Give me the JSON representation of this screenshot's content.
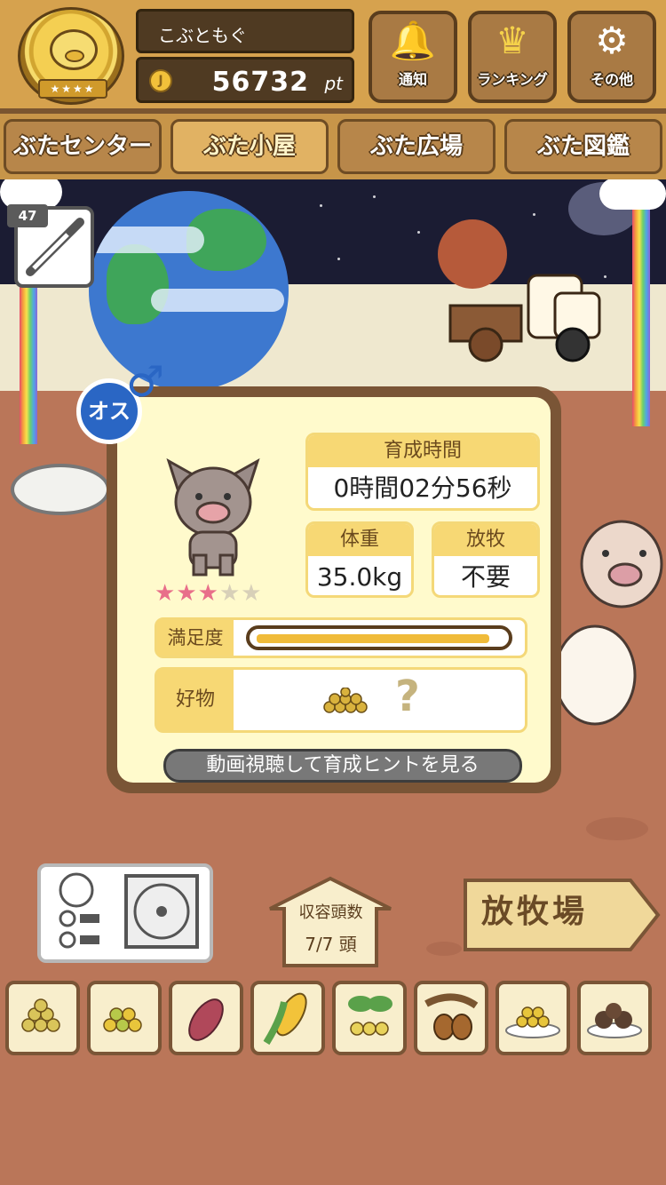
{
  "header": {
    "player_name": "こぶともぐ",
    "coin_symbol": "J",
    "points": "56732",
    "points_unit": "pt",
    "medal_stars": "★★★★",
    "buttons": {
      "notify": "通知",
      "ranking": "ランキング",
      "other": "その他"
    }
  },
  "tabs": {
    "center": "ぶたセンター",
    "hut": "ぶた小屋",
    "plaza": "ぶた広場",
    "book": "ぶた図鑑",
    "active": "hut"
  },
  "medicine": {
    "count": "47"
  },
  "pig_status": {
    "gender_label": "オス",
    "gender_symbol": "♂",
    "rearing_time_label": "育成時間",
    "rearing_time": "0時間02分56秒",
    "weight_label": "体重",
    "weight": "35.0kg",
    "grazing_label": "放牧",
    "grazing": "不要",
    "stars_filled": 3,
    "stars_total": 5,
    "satisfaction_label": "満足度",
    "satisfaction_level": 0.95,
    "favorite_label": "好物",
    "favorite_unknown": "?",
    "hint_button": "動画視聴して育成ヒントを見る"
  },
  "bottom": {
    "capacity_label": "収容頭数",
    "capacity_value": "7/7 頭",
    "pasture_sign": "放牧場"
  },
  "food_items": [
    "soybeans",
    "mixed-grain",
    "sweet-potato",
    "corn",
    "beans-sprout",
    "acorn",
    "grain-plate",
    "meatball-plate"
  ],
  "colors": {
    "header_wood": "#d6a24e",
    "accent_yellow": "#f7d874",
    "mars_ground": "#ba7659",
    "gender_blue": "#2a66c4",
    "star_pink": "#e86f8a"
  }
}
